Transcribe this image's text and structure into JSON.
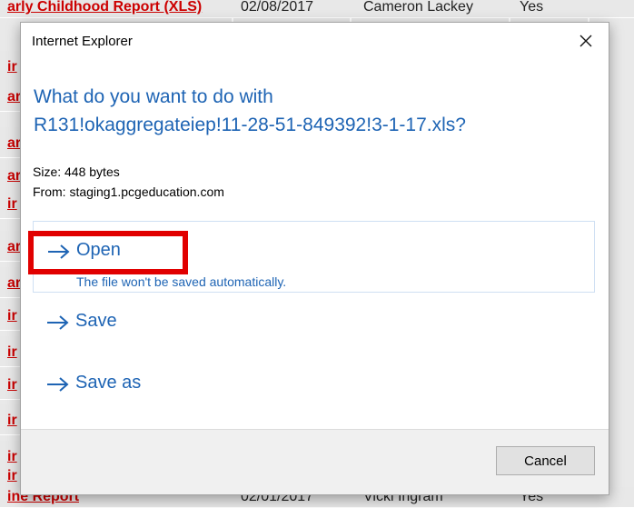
{
  "background": {
    "top_row": {
      "report": "arly Childhood Report (XLS)",
      "date": "02/08/2017",
      "person": "Cameron Lackey",
      "flag": "Yes"
    },
    "left_fragments": [
      "ir",
      "ar",
      "ar",
      "ar",
      "ir",
      "ar",
      "ar",
      "ir",
      "ir",
      "ir",
      "ir",
      "ir",
      "ir"
    ],
    "bottom_row": {
      "report": "ine Report",
      "date": "02/01/2017",
      "person": "Vicki Ingram",
      "flag": "Yes"
    }
  },
  "dialog": {
    "title": "Internet Explorer",
    "question_line1": "What do you want to do with",
    "question_line2": "R131!okaggregateiep!11-28-51-849392!3-1-17.xls?",
    "size": "Size: 448 bytes",
    "from": "From: staging1.pcgeducation.com",
    "options": {
      "open": {
        "label": "Open",
        "sub": "The file won't be saved automatically."
      },
      "save": {
        "label": "Save"
      },
      "save_as": {
        "label": "Save as"
      }
    },
    "cancel_label": "Cancel"
  },
  "colors": {
    "accent": "#1e64b4",
    "highlight_box": "#e10000",
    "link_red": "#cc0000"
  },
  "icons": {
    "close": "close-icon",
    "arrow": "arrow-right-icon"
  }
}
